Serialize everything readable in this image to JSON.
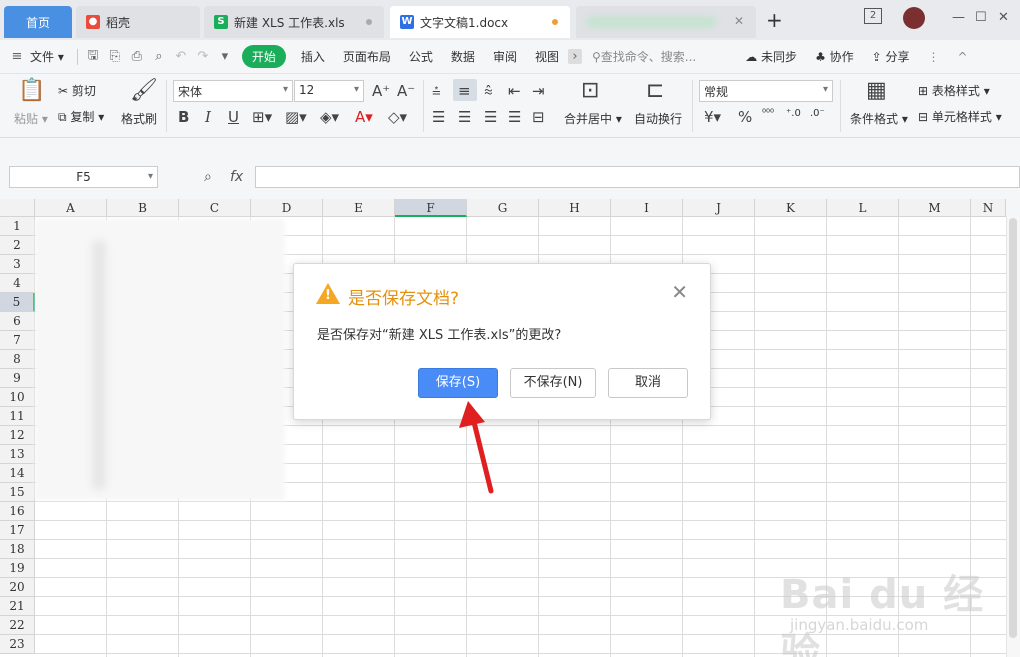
{
  "tabs": {
    "home": "首页",
    "daoke": "稻壳",
    "xls": "新建 XLS 工作表.xls",
    "doc": "文字文稿1.docx",
    "add": "+"
  },
  "window": {
    "badge": "2"
  },
  "menu": {
    "file": "文件",
    "start": "开始",
    "insert": "插入",
    "layout": "页面布局",
    "formula": "公式",
    "data": "数据",
    "review": "审阅",
    "view": "视图",
    "search": "查找命令、搜索...",
    "sync": "未同步",
    "collab": "协作",
    "share": "分享"
  },
  "ribbon": {
    "paste": "粘贴",
    "cut": "剪切",
    "copy": "复制",
    "format_painter": "格式刷",
    "font_name": "宋体",
    "font_size": "12",
    "merge_center": "合并居中",
    "wrap": "自动换行",
    "number_format": "常规",
    "percent": "%",
    "conditional": "条件格式",
    "table_style": "表格样式",
    "cell_style": "单元格样式"
  },
  "formula_bar": {
    "cell_ref": "F5",
    "fx": "fx"
  },
  "grid": {
    "columns": [
      "A",
      "B",
      "C",
      "D",
      "E",
      "F",
      "G",
      "H",
      "I",
      "J",
      "K",
      "L",
      "M",
      "N"
    ],
    "rows": [
      "1",
      "2",
      "3",
      "4",
      "5",
      "6",
      "7",
      "8",
      "9",
      "10",
      "11",
      "12",
      "13",
      "14",
      "15",
      "16",
      "17",
      "18",
      "19",
      "20",
      "21",
      "22",
      "23"
    ],
    "selected_col": "F",
    "selected_row": "5"
  },
  "dialog": {
    "title": "是否保存文档?",
    "message": "是否保存对“新建 XLS 工作表.xls”的更改?",
    "save": "保存(S)",
    "no_save": "不保存(N)",
    "cancel": "取消"
  },
  "colors": {
    "accent_green": "#1aad5a",
    "primary_blue": "#4a8cf7",
    "warning_orange": "#e6910c",
    "arrow_red": "#e02020"
  }
}
